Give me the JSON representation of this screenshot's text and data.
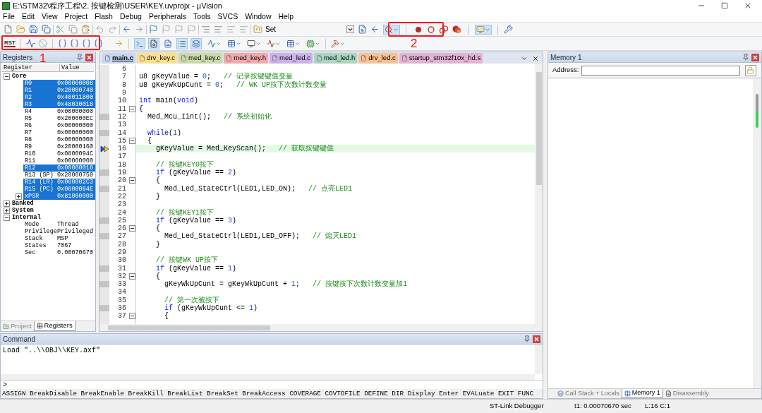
{
  "window": {
    "title": "E:\\STM32\\程序工程\\2. 按键检测\\USER\\KEY.uvprojx - µVision"
  },
  "menu": [
    "File",
    "Edit",
    "View",
    "Project",
    "Flash",
    "Debug",
    "Peripherals",
    "Tools",
    "SVCS",
    "Window",
    "Help"
  ],
  "toolbar": {
    "set_label": "Set",
    "reset_label": "RST"
  },
  "annotations": [
    {
      "label": "1"
    },
    {
      "label": "2"
    }
  ],
  "registers_panel": {
    "title": "Registers",
    "columns": [
      "Register",
      "Value"
    ],
    "groups": [
      {
        "name": "Core",
        "expanded": true,
        "children": [
          {
            "name": "R0",
            "value": "0x00000008",
            "selected": true
          },
          {
            "name": "R1",
            "value": "0x20000740",
            "selected": true
          },
          {
            "name": "R2",
            "value": "0x40011800",
            "selected": true
          },
          {
            "name": "R3",
            "value": "0x48030018",
            "selected": true
          },
          {
            "name": "R4",
            "value": "0x00000000",
            "selected": false
          },
          {
            "name": "R5",
            "value": "0x200000EC",
            "selected": false
          },
          {
            "name": "R6",
            "value": "0x00000000",
            "selected": false
          },
          {
            "name": "R7",
            "value": "0x00000000",
            "selected": false
          },
          {
            "name": "R8",
            "value": "0x00000000",
            "selected": false
          },
          {
            "name": "R9",
            "value": "0x20000160",
            "selected": false
          },
          {
            "name": "R10",
            "value": "0x0800094C",
            "selected": false
          },
          {
            "name": "R11",
            "value": "0x00000000",
            "selected": false
          },
          {
            "name": "R12",
            "value": "0x00000018",
            "selected": true
          },
          {
            "name": "R13 (SP)",
            "value": "0x20000750",
            "selected": false
          },
          {
            "name": "R14 (LR)",
            "value": "0x080002C3",
            "selected": true
          },
          {
            "name": "R15 (PC)",
            "value": "0x0800084E",
            "selected": true
          },
          {
            "name": "xPSR",
            "value": "0x81000000",
            "selected": true,
            "expanded": false
          }
        ]
      },
      {
        "name": "Banked",
        "expanded": false
      },
      {
        "name": "System",
        "expanded": false
      },
      {
        "name": "Internal",
        "expanded": true,
        "children": [
          {
            "name": "Mode",
            "value": "Thread",
            "selected": false
          },
          {
            "name": "Privilege",
            "value": "Privileged",
            "selected": false
          },
          {
            "name": "Stack",
            "value": "MSP",
            "selected": false
          },
          {
            "name": "States",
            "value": "7067",
            "selected": false
          },
          {
            "name": "Sec",
            "value": "0.00070670",
            "selected": false
          }
        ]
      }
    ]
  },
  "left_tabs": [
    {
      "label": "Project",
      "selected": false
    },
    {
      "label": "Registers",
      "selected": true
    }
  ],
  "editor_tabs": [
    {
      "label": "main.c",
      "selected": true,
      "color": "#c9d6f2"
    },
    {
      "label": "drv_key.c",
      "selected": false,
      "color": "#fbdf8e"
    },
    {
      "label": "med_key.c",
      "selected": false,
      "color": "#c9d9a9"
    },
    {
      "label": "med_key.h",
      "selected": false,
      "color": "#f1a9a9"
    },
    {
      "label": "med_led.c",
      "selected": false,
      "color": "#cbb3ea"
    },
    {
      "label": "med_led.h",
      "selected": false,
      "color": "#a9d5c1"
    },
    {
      "label": "drv_led.c",
      "selected": false,
      "color": "#f9c292"
    },
    {
      "label": "startup_stm32f10x_hd.s",
      "selected": false,
      "color": "#e2b3d3"
    }
  ],
  "code_lines": [
    {
      "number": "6"
    },
    {
      "number": "7",
      "segments": [
        {
          "kind": "plain",
          "text": "u8 gKeyValue = "
        },
        {
          "kind": "number",
          "text": "0"
        },
        {
          "kind": "plain",
          "text": ";   "
        },
        {
          "kind": "comment",
          "text": "// 记录按键键值变量"
        }
      ]
    },
    {
      "number": "8",
      "segments": [
        {
          "kind": "plain",
          "text": "u8 gKeyWkUpCunt = "
        },
        {
          "kind": "number",
          "text": "0"
        },
        {
          "kind": "plain",
          "text": ";   "
        },
        {
          "kind": "comment",
          "text": "// WK UP按下次数计数变量"
        }
      ]
    },
    {
      "number": "9"
    },
    {
      "number": "10",
      "segments": [
        {
          "kind": "keyword",
          "text": "int"
        },
        {
          "kind": "plain",
          "text": " main("
        },
        {
          "kind": "keyword",
          "text": "void"
        },
        {
          "kind": "plain",
          "text": ")"
        }
      ]
    },
    {
      "number": "11",
      "fold": true,
      "segments": [
        {
          "kind": "plain",
          "text": "{"
        }
      ]
    },
    {
      "number": "12",
      "executable": true,
      "segments": [
        {
          "kind": "plain",
          "text": "  Med_Mcu_Iint();   "
        },
        {
          "kind": "comment",
          "text": "// 系统初始化"
        }
      ]
    },
    {
      "number": "13"
    },
    {
      "number": "14",
      "executable": true,
      "segments": [
        {
          "kind": "keyword",
          "text": "  while"
        },
        {
          "kind": "plain",
          "text": "("
        },
        {
          "kind": "number",
          "text": "1"
        },
        {
          "kind": "plain",
          "text": ")"
        }
      ]
    },
    {
      "number": "15",
      "fold": true,
      "segments": [
        {
          "kind": "plain",
          "text": "  {"
        }
      ]
    },
    {
      "number": "16",
      "current": true,
      "segments": [
        {
          "kind": "plain",
          "text": "    gKeyValue = Med_KeyScan();   "
        },
        {
          "kind": "comment",
          "text": "// 获取按键键值"
        }
      ]
    },
    {
      "number": "17"
    },
    {
      "number": "18",
      "segments": [
        {
          "kind": "comment",
          "text": "    // 按键KEY0按下"
        }
      ]
    },
    {
      "number": "19",
      "executable": true,
      "segments": [
        {
          "kind": "keyword",
          "text": "    if"
        },
        {
          "kind": "plain",
          "text": " (gKeyValue == "
        },
        {
          "kind": "number",
          "text": "2"
        },
        {
          "kind": "plain",
          "text": ")"
        }
      ]
    },
    {
      "number": "20",
      "fold": true,
      "segments": [
        {
          "kind": "plain",
          "text": "    {"
        }
      ]
    },
    {
      "number": "21",
      "executable": true,
      "segments": [
        {
          "kind": "plain",
          "text": "      Med_Led_StateCtrl(LED1,LED_ON);   "
        },
        {
          "kind": "comment",
          "text": "// 点亮LED1"
        }
      ]
    },
    {
      "number": "22",
      "segments": [
        {
          "kind": "plain",
          "text": "    }"
        }
      ]
    },
    {
      "number": "23"
    },
    {
      "number": "24",
      "segments": [
        {
          "kind": "comment",
          "text": "    // 按键KEY1按下"
        }
      ]
    },
    {
      "number": "25",
      "executable": true,
      "segments": [
        {
          "kind": "keyword",
          "text": "    if"
        },
        {
          "kind": "plain",
          "text": " (gKeyValue == "
        },
        {
          "kind": "number",
          "text": "3"
        },
        {
          "kind": "plain",
          "text": ")"
        }
      ]
    },
    {
      "number": "26",
      "fold": true,
      "segments": [
        {
          "kind": "plain",
          "text": "    {"
        }
      ]
    },
    {
      "number": "27",
      "executable": true,
      "segments": [
        {
          "kind": "plain",
          "text": "      Med_Led_StateCtrl(LED1,LED_OFF);   "
        },
        {
          "kind": "comment",
          "text": "// 熄灭LED1"
        }
      ]
    },
    {
      "number": "28",
      "segments": [
        {
          "kind": "plain",
          "text": "    }"
        }
      ]
    },
    {
      "number": "29"
    },
    {
      "number": "30",
      "segments": [
        {
          "kind": "comment",
          "text": "    // 按键WK UP按下"
        }
      ]
    },
    {
      "number": "31",
      "executable": true,
      "segments": [
        {
          "kind": "keyword",
          "text": "    if"
        },
        {
          "kind": "plain",
          "text": " (gKeyValue == "
        },
        {
          "kind": "number",
          "text": "1"
        },
        {
          "kind": "plain",
          "text": ")"
        }
      ]
    },
    {
      "number": "32",
      "fold": true,
      "segments": [
        {
          "kind": "plain",
          "text": "    {"
        }
      ]
    },
    {
      "number": "33",
      "executable": true,
      "segments": [
        {
          "kind": "plain",
          "text": "      gKeyWkUpCunt = gKeyWkUpCunt + "
        },
        {
          "kind": "number",
          "text": "1"
        },
        {
          "kind": "plain",
          "text": ";   "
        },
        {
          "kind": "comment",
          "text": "// 按键按下次数计数变量加1"
        }
      ]
    },
    {
      "number": "34"
    },
    {
      "number": "35",
      "segments": [
        {
          "kind": "comment",
          "text": "      // 第一次被按下"
        }
      ]
    },
    {
      "number": "36",
      "executable": true,
      "segments": [
        {
          "kind": "keyword",
          "text": "      if"
        },
        {
          "kind": "plain",
          "text": " (gKeyWkUpCunt <= "
        },
        {
          "kind": "number",
          "text": "1"
        },
        {
          "kind": "plain",
          "text": ")"
        }
      ]
    },
    {
      "number": "37",
      "fold": true,
      "segments": [
        {
          "kind": "plain",
          "text": "      {"
        }
      ]
    }
  ],
  "memory_panel": {
    "title": "Memory 1",
    "address_label": "Address:"
  },
  "right_tabs": [
    {
      "label": "Call Stack + Locals",
      "selected": false
    },
    {
      "label": "Memory 1",
      "selected": true
    },
    {
      "label": "Disassembly",
      "selected": false
    }
  ],
  "command_panel": {
    "title": "Command",
    "output": "Load \"..\\\\OBJ\\\\KEY.axf\"",
    "prompt": ">",
    "hint": "ASSIGN BreakDisable BreakEnable BreakKill BreakList BreakSet BreakAccess COVERAGE COVTOFILE DEFINE DIR Display Enter EVALuate EXIT FUNC"
  },
  "status_bar": [
    "ST-Link Debugger",
    "t1: 0.00070670 sec",
    "L:16 C:1"
  ]
}
